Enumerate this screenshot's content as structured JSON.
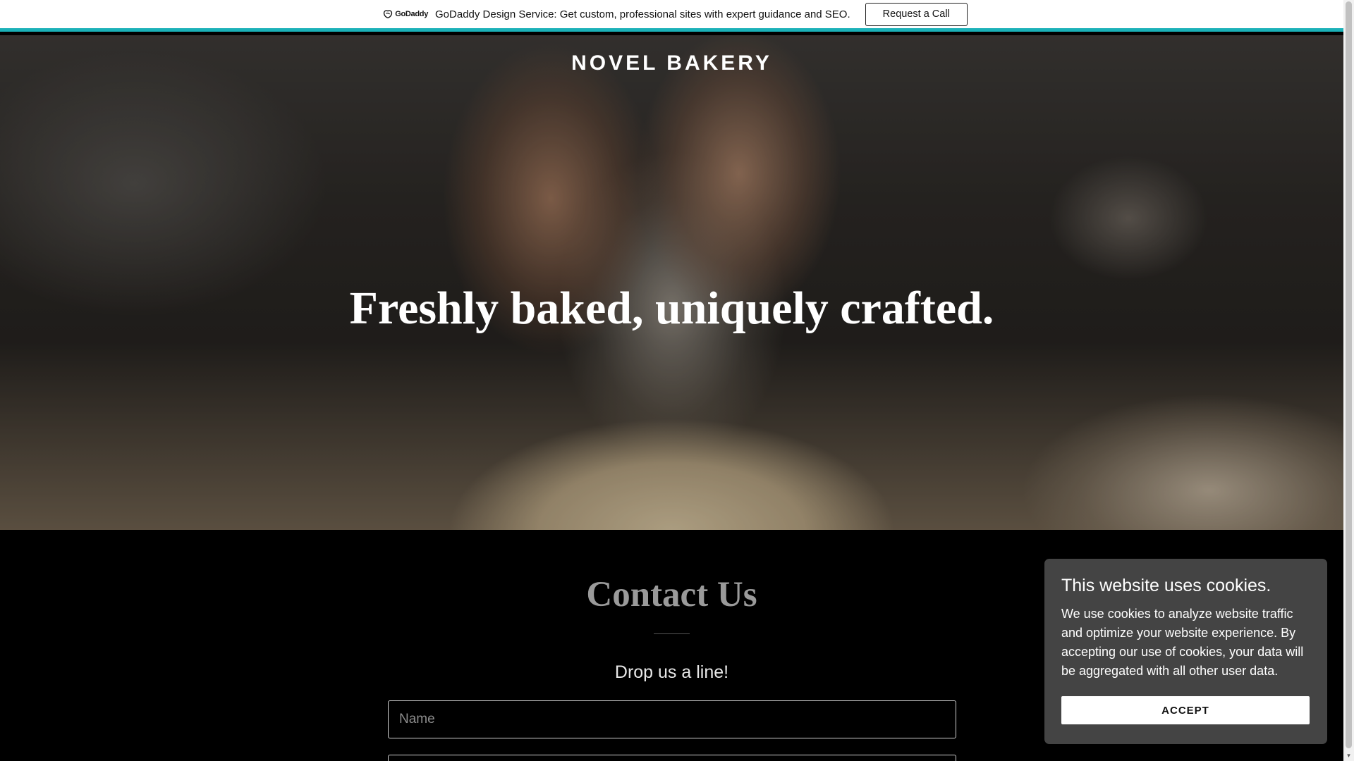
{
  "promo": {
    "logo_text": "GoDaddy",
    "message": "GoDaddy Design Service: Get custom, professional sites with expert guidance and SEO.",
    "button_label": "Request a Call",
    "accent_color": "#1bb1b8"
  },
  "hero": {
    "brand": "NOVEL BAKERY",
    "heading": "Freshly baked, uniquely crafted."
  },
  "contact": {
    "title": "Contact Us",
    "subtitle": "Drop us a line!",
    "name_placeholder": "Name"
  },
  "cookie": {
    "title": "This website uses cookies.",
    "body": "We use cookies to analyze website traffic and optimize your website experience. By accepting our use of cookies, your data will be aggregated with all other user data.",
    "accept_label": "ACCEPT"
  },
  "icons": {
    "logo": "godaddy-logo-icon",
    "scroll_down": "chevron-down-icon"
  }
}
